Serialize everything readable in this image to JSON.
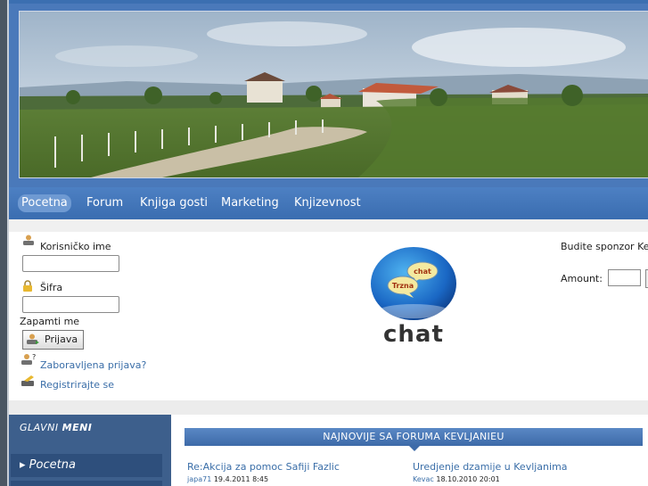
{
  "nav": {
    "items": [
      {
        "label": "Pocetna",
        "active": true
      },
      {
        "label": "Forum"
      },
      {
        "label": "Knjiga gosti"
      },
      {
        "label": "Marketing"
      },
      {
        "label": "Knjizevnost"
      }
    ]
  },
  "login": {
    "username_label": "Korisničko ime",
    "password_label": "Šifra",
    "remember_label": "Zapamti me",
    "login_button": "Prijava",
    "forgot_link": "Zaboravljena prijava?",
    "register_link": "Registrirajte se"
  },
  "chat": {
    "bubble_top": "chat",
    "bubble_bottom": "Trzna",
    "word": "chat"
  },
  "sponsor": {
    "text": "Budite sponzor Ke",
    "amount_label": "Amount:"
  },
  "main_menu": {
    "title_part1": "GLAVNI",
    "title_part2": "MENI",
    "items": [
      {
        "label": "Pocetna"
      }
    ]
  },
  "forum": {
    "title": "NAJNOVIJE SA FORUMA KEVLJANIEU",
    "posts": [
      {
        "title": "Re:Akcija za pomoc Safiji Fazlic",
        "author": "japa71",
        "date": "19.4.2011 8:45"
      },
      {
        "title": "Uredjenje dzamije u Kevljanima",
        "author": "Kevac",
        "date": "18.10.2010 20:01"
      }
    ]
  },
  "colors": {
    "header_blue": "#4a79ba",
    "link_blue": "#3a6ea8",
    "menu_dark": "#3d5f8c"
  }
}
